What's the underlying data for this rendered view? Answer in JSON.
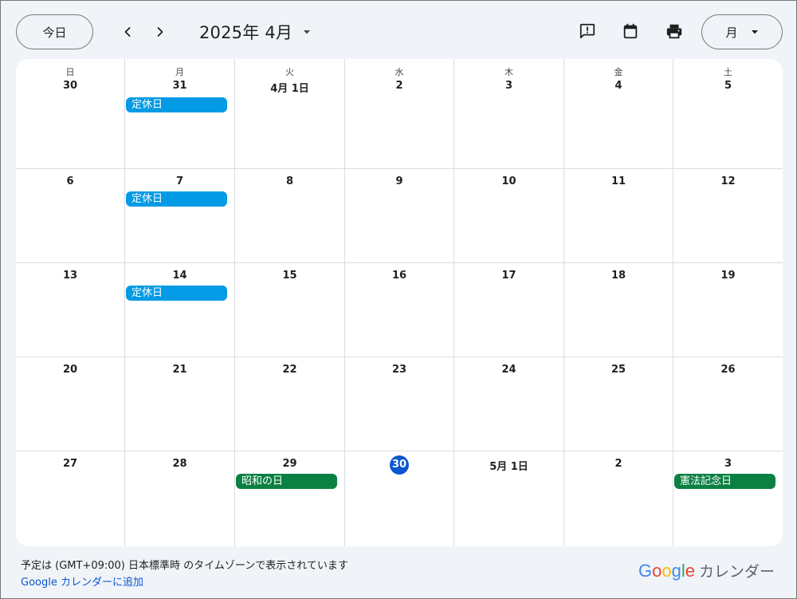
{
  "toolbar": {
    "today_label": "今日",
    "month_title": "2025年 4月",
    "view_label": "月",
    "icons": [
      "feedback-icon",
      "calendar-icon",
      "print-icon"
    ]
  },
  "weekdays": [
    "日",
    "月",
    "火",
    "水",
    "木",
    "金",
    "土"
  ],
  "weeks": [
    [
      {
        "label": "30"
      },
      {
        "label": "31",
        "event": {
          "title": "定休日",
          "color": "#039be5"
        }
      },
      {
        "label": "4月 1日"
      },
      {
        "label": "2"
      },
      {
        "label": "3"
      },
      {
        "label": "4"
      },
      {
        "label": "5"
      }
    ],
    [
      {
        "label": "6"
      },
      {
        "label": "7",
        "event": {
          "title": "定休日",
          "color": "#039be5"
        }
      },
      {
        "label": "8"
      },
      {
        "label": "9"
      },
      {
        "label": "10"
      },
      {
        "label": "11"
      },
      {
        "label": "12"
      }
    ],
    [
      {
        "label": "13"
      },
      {
        "label": "14",
        "event": {
          "title": "定休日",
          "color": "#039be5"
        }
      },
      {
        "label": "15"
      },
      {
        "label": "16"
      },
      {
        "label": "17"
      },
      {
        "label": "18"
      },
      {
        "label": "19"
      }
    ],
    [
      {
        "label": "20"
      },
      {
        "label": "21"
      },
      {
        "label": "22"
      },
      {
        "label": "23"
      },
      {
        "label": "24"
      },
      {
        "label": "25"
      },
      {
        "label": "26"
      }
    ],
    [
      {
        "label": "27"
      },
      {
        "label": "28"
      },
      {
        "label": "29",
        "event": {
          "title": "昭和の日",
          "color": "#0b8043"
        }
      },
      {
        "label": "30",
        "today": true
      },
      {
        "label": "5月 1日"
      },
      {
        "label": "2"
      },
      {
        "label": "3",
        "event": {
          "title": "憲法記念日",
          "color": "#0b8043"
        }
      }
    ]
  ],
  "footer": {
    "timezone_text": "予定は (GMT+09:00) 日本標準時 のタイムゾーンで表示されています",
    "add_link": "Google カレンダーに追加",
    "brand_google": "Google",
    "brand_label": "カレンダー",
    "brand_colors": [
      "#4285f4",
      "#ea4335",
      "#fbbc05",
      "#4285f4",
      "#34a853",
      "#ea4335"
    ]
  },
  "colors": {
    "today_circle": "#0b57d0",
    "link": "#0b57d0"
  }
}
